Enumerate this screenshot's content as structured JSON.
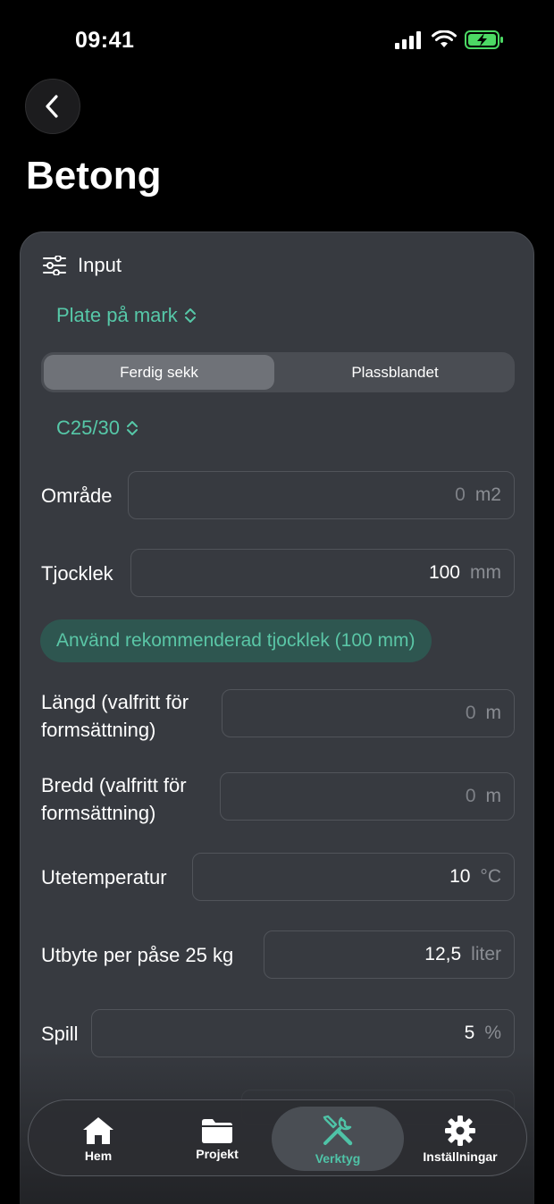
{
  "status_bar": {
    "time": "09:41"
  },
  "page": {
    "title": "Betong"
  },
  "card": {
    "header_label": "Input",
    "type_picker": "Plate på mark",
    "segments": [
      "Ferdig sekk",
      "Plassblandet"
    ],
    "active_segment": "Ferdig sekk",
    "strength_picker": "C25/30",
    "fields": [
      {
        "label": "Område",
        "value": "0",
        "unit": "m2",
        "placeholder": true
      },
      {
        "label": "Tjocklek",
        "value": "100",
        "unit": "mm",
        "placeholder": false
      },
      {
        "label": "Längd (valfritt för formsättning)",
        "value": "0",
        "unit": "m",
        "placeholder": true
      },
      {
        "label": "Bredd (valfritt för formsättning)",
        "value": "0",
        "unit": "m",
        "placeholder": true
      },
      {
        "label": "Utetemperatur",
        "value": "10",
        "unit": "°C",
        "placeholder": false
      },
      {
        "label": "Utbyte per påse 25 kg",
        "value": "12,5",
        "unit": "liter",
        "placeholder": false
      },
      {
        "label": "Spill",
        "value": "5",
        "unit": "%",
        "placeholder": false
      }
    ],
    "recommend_button": "Använd rekommenderad tjocklek (100 mm)"
  },
  "tab_bar": {
    "items": [
      {
        "label": "Hem",
        "icon": "house-icon"
      },
      {
        "label": "Projekt",
        "icon": "folder-icon"
      },
      {
        "label": "Verktyg",
        "icon": "tools-icon"
      },
      {
        "label": "Inställningar",
        "icon": "gear-icon"
      }
    ],
    "active": "Verktyg"
  },
  "colors": {
    "accent": "#56c8a8",
    "card_bg": "#373a40",
    "background": "#000000"
  }
}
